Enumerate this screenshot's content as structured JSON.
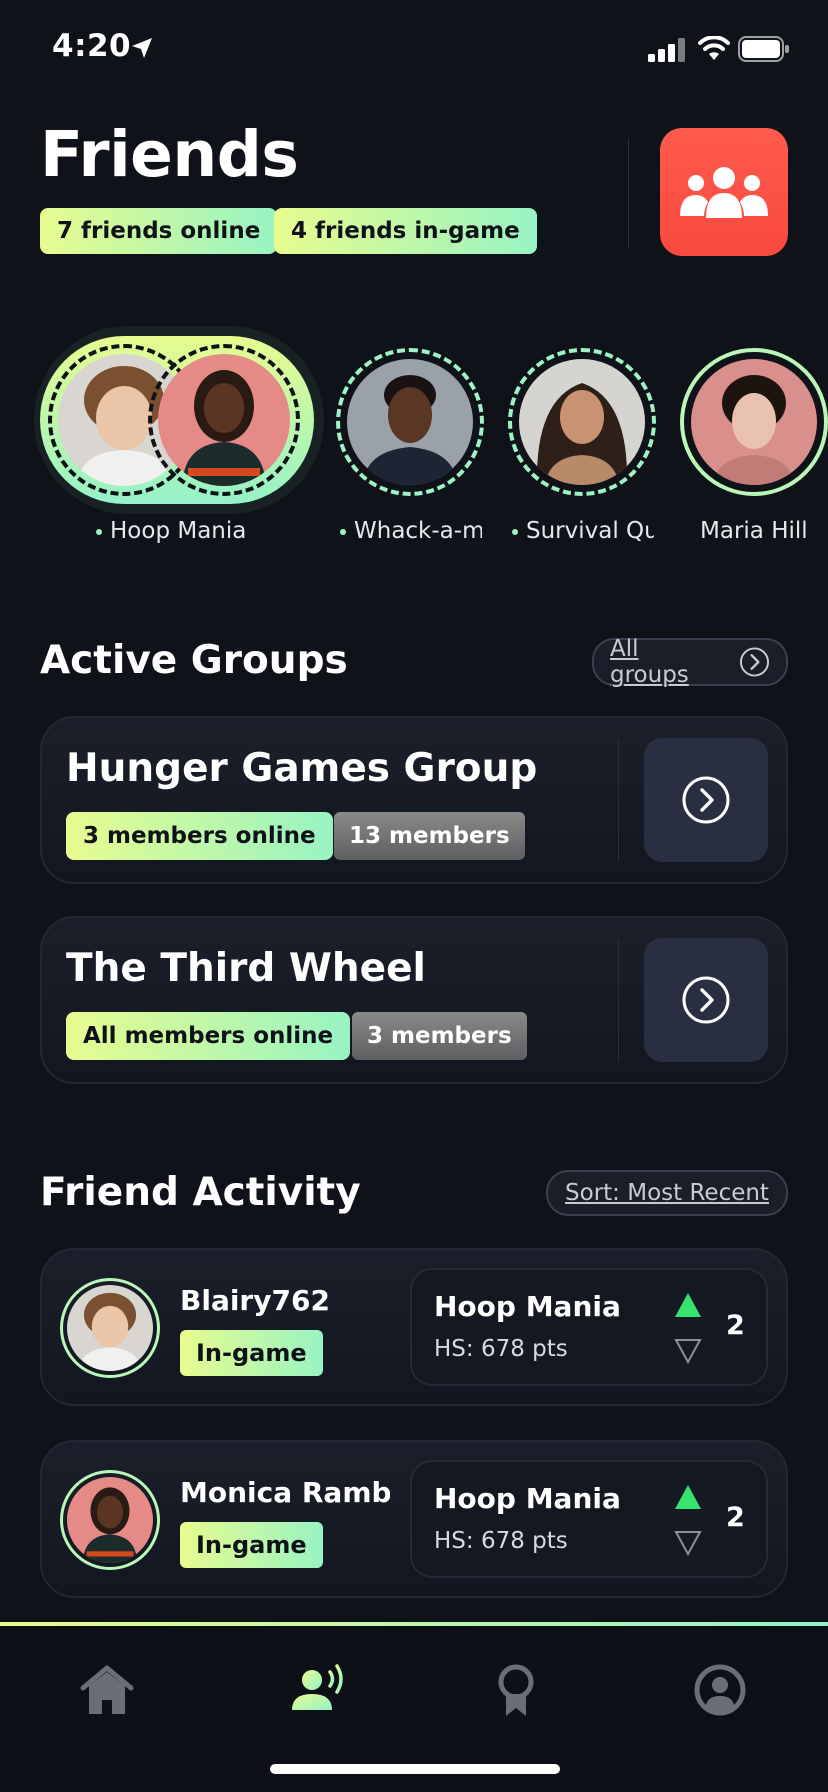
{
  "status_bar": {
    "time": "4:20"
  },
  "header": {
    "title": "Friends",
    "online_badge": "7 friends online",
    "ingame_badge": "4 friends in-game"
  },
  "avatars": [
    {
      "label": "Hoop Mania",
      "online": true
    },
    {
      "label": "Whack-a-mole",
      "online": true
    },
    {
      "label": "Survival Quest",
      "online": true
    },
    {
      "label": "Maria Hill",
      "online": false
    }
  ],
  "active_groups": {
    "title": "Active Groups",
    "all_label": "All groups",
    "groups": [
      {
        "name": "Hunger Games Group",
        "online": "3 members online",
        "members": "13 members"
      },
      {
        "name": "The Third Wheel",
        "online": "All members online",
        "members": "3 members"
      }
    ]
  },
  "activity": {
    "title": "Friend Activity",
    "sort_label": "Sort: Most Recent",
    "items": [
      {
        "name": "Blairy762",
        "status": "In-game",
        "game": "Hoop Mania",
        "score": "HS: 678 pts",
        "rank": "2"
      },
      {
        "name": "Monica Rambeau",
        "status": "In-game",
        "game": "Hoop Mania",
        "score": "HS: 678 pts",
        "rank": "2"
      }
    ]
  },
  "nav": [
    "home-icon",
    "friends-icon",
    "award-icon",
    "profile-icon"
  ],
  "colors": {
    "accent_start": "#e7fc8f",
    "accent_end": "#95f2c8",
    "brand_red": "#ff5a4e",
    "background": "#0f1219"
  }
}
